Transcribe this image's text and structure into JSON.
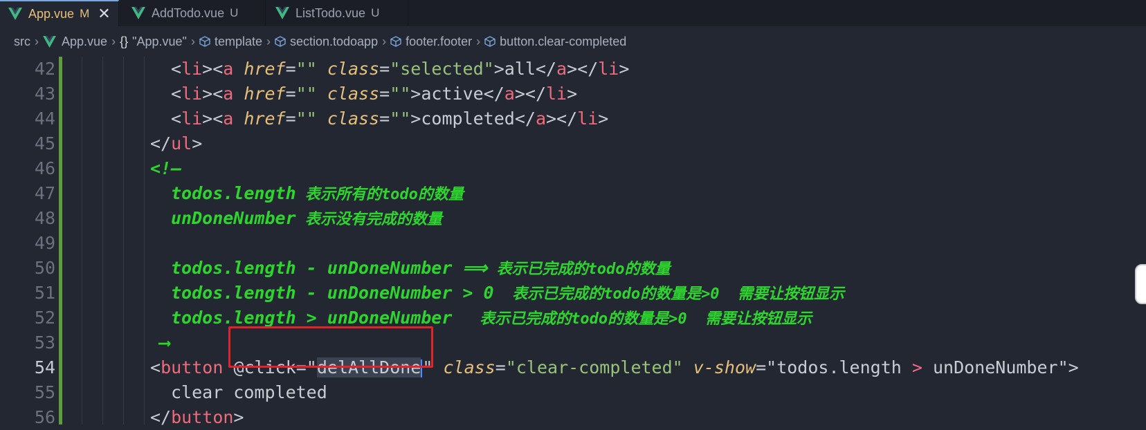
{
  "tabs": [
    {
      "name": "App.vue",
      "status": "M",
      "active": true
    },
    {
      "name": "AddTodo.vue",
      "status": "U",
      "active": false
    },
    {
      "name": "ListTodo.vue",
      "status": "U",
      "active": false
    }
  ],
  "tab_close_glyph": "✕",
  "breadcrumb": {
    "src": "src",
    "file": "App.vue",
    "braces": "{}",
    "script": "\"App.vue\"",
    "template": "template",
    "section": "section.todoapp",
    "footer": "footer.footer",
    "button": "button.clear-completed"
  },
  "colors": {
    "accent": "#528bff",
    "git_modified": "#5d9c3f",
    "highlight": "#e0242b",
    "comment": "#2fd52f"
  },
  "editor": {
    "line_numbers": [
      "42",
      "43",
      "44",
      "45",
      "46",
      "47",
      "48",
      "49",
      "50",
      "51",
      "52",
      "53",
      "54",
      "55",
      "56"
    ],
    "current_line": "54",
    "l42": {
      "lt": "<",
      "li": "li",
      "gt": ">",
      "a": "a",
      "href": "href",
      "eq": "=",
      "q1": "\"\"",
      "class": "class",
      "val": "\"selected\"",
      "text": "all",
      "end": "</"
    },
    "l43": {
      "val": "\"\"",
      "text": "active"
    },
    "l44": {
      "val": "\"\"",
      "text": "completed"
    },
    "comment_open": "<!—",
    "c47": {
      "a": "todos.length",
      "b": " 表示所有的todo的数量"
    },
    "c48": {
      "a": "unDoneNumber",
      "b": " 表示没有完成的数量"
    },
    "c50": {
      "a": "todos.length - unDoneNumber ⟹",
      "b": " 表示已完成的todo的数量"
    },
    "c51": {
      "a": "todos.length - unDoneNumber > 0",
      "b": "  表示已完成的todo的数量是>0  需要让按钮显示"
    },
    "c52": {
      "a": "todos.length > unDoneNumber",
      "b": "   表示已完成的todo的数量是>0  需要让按钮显示"
    },
    "comment_close": "⟶",
    "l54": {
      "button": "button",
      "click": "@click",
      "handler": "delAllDone",
      "class_attr": "class",
      "class_val": "\"clear-completed\"",
      "vshow": "v-show",
      "vshow_a": "\"todos.length ",
      "vshow_op": ">",
      "vshow_b": " unDoneNumber\""
    },
    "l55": "clear completed",
    "l56": "button"
  }
}
